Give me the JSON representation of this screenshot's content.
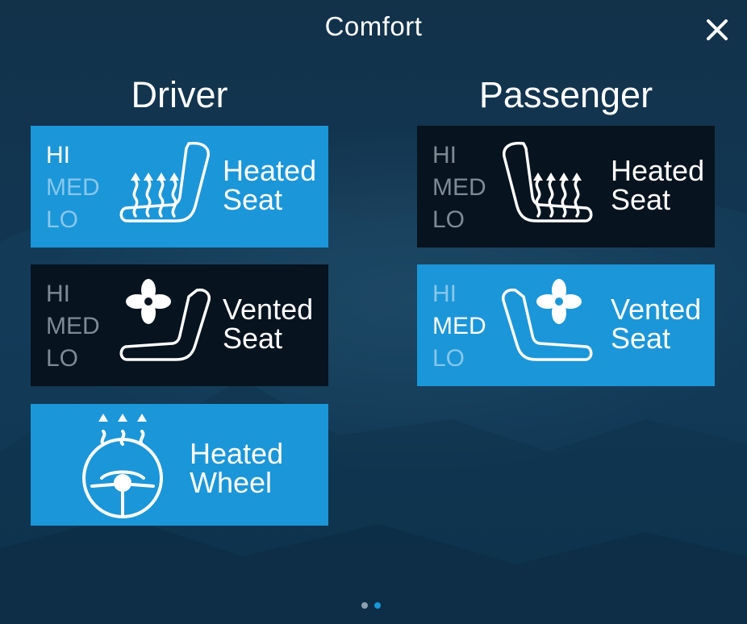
{
  "header": {
    "title": "Comfort"
  },
  "columns": {
    "driver": "Driver",
    "passenger": "Passenger"
  },
  "driver": {
    "heated_seat": {
      "levels": [
        "HI",
        "MED",
        "LO"
      ],
      "selected": "HI",
      "label_line1": "Heated",
      "label_line2": "Seat"
    },
    "vented_seat": {
      "levels": [
        "HI",
        "MED",
        "LO"
      ],
      "selected": null,
      "label_line1": "Vented",
      "label_line2": "Seat"
    },
    "heated_wheel": {
      "label_line1": "Heated",
      "label_line2": "Wheel"
    }
  },
  "passenger": {
    "heated_seat": {
      "levels": [
        "HI",
        "MED",
        "LO"
      ],
      "selected": null,
      "label_line1": "Heated",
      "label_line2": "Seat"
    },
    "vented_seat": {
      "levels": [
        "HI",
        "MED",
        "LO"
      ],
      "selected": "MED",
      "label_line1": "Vented",
      "label_line2": "Seat"
    }
  },
  "pagination": {
    "pages": 2,
    "current": 2
  },
  "colors": {
    "active": "#1b96d8",
    "inactive": "#07131e",
    "inactive_text": "#7e8b95",
    "active_dim_text": "#86c7ec"
  },
  "icons": {
    "close": "close-icon",
    "heated_seat": "heated-seat-icon",
    "vented_seat": "vented-seat-icon",
    "heated_wheel": "heated-steering-wheel-icon"
  }
}
